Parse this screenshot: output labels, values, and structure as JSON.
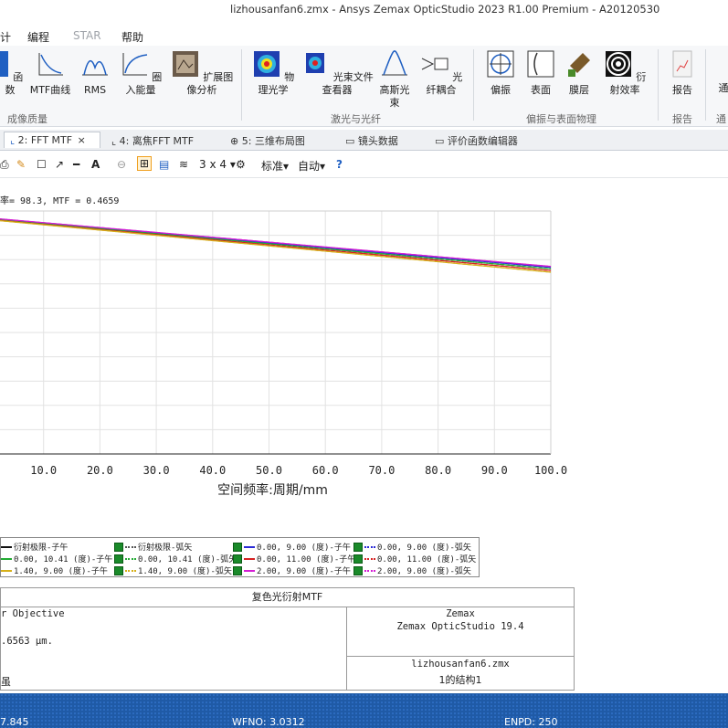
{
  "window": {
    "title": "lizhousanfan6.zmx - Ansys Zemax OpticStudio 2023 R1.00   Premium - A20120530"
  },
  "menu": {
    "items": [
      "计",
      "编程",
      "STAR",
      "帮助"
    ]
  },
  "ribbon": {
    "group1": {
      "buttons": [
        "函数",
        "MTF曲线",
        "RMS",
        "圈入能量",
        "扩展图像分析"
      ],
      "label": "成像质量"
    },
    "group2": {
      "buttons": [
        "物理光学",
        "光束文件查看器",
        "高斯光束",
        "光纤耦合"
      ],
      "label": "激光与光纤"
    },
    "group3": {
      "buttons": [
        "偏振",
        "表面",
        "膜层",
        "衍射效率"
      ],
      "label": "偏振与表面物理"
    },
    "group4": {
      "buttons": [
        "报告"
      ],
      "label": "报告"
    },
    "group5": {
      "buttons": [
        "通"
      ],
      "label": "通"
    }
  },
  "tabs": [
    {
      "label": "2: FFT MTF",
      "close": "×",
      "active": true
    },
    {
      "label": "4: 离焦FFT MTF",
      "active": false
    },
    {
      "label": "5: 三维布局图",
      "active": false
    },
    {
      "label": "镜头数据",
      "active": false
    },
    {
      "label": "评价函数编辑器",
      "active": false
    }
  ],
  "toolbar": {
    "layout": "3 x 4",
    "layout_arrow": "▾",
    "standard": "标准",
    "auto": "自动",
    "dropdown_arrow": "▾"
  },
  "plot_header": "率= 98.3, MTF = 0.4659",
  "chart_data": {
    "type": "line",
    "xlabel": "空间频率:周期/mm",
    "ylabel": "",
    "x_ticks": [
      "10.0",
      "20.0",
      "30.0",
      "40.0",
      "50.0",
      "60.0",
      "70.0",
      "80.0",
      "90.0",
      "100.0"
    ],
    "x_range_visible": [
      0,
      100
    ],
    "y_range": [
      0,
      1.0
    ],
    "grid": true,
    "series": [
      {
        "name": "衍射极限-子午",
        "color": "#111111",
        "x": [
          0,
          100
        ],
        "y": [
          0.97,
          0.77
        ]
      },
      {
        "name": "衍射极限-弧矢",
        "color": "#555555",
        "x": [
          0,
          100
        ],
        "y": [
          0.97,
          0.77
        ]
      },
      {
        "name": "0.00, 9.00 (度)-子午",
        "color": "#2b2bd6",
        "x": [
          0,
          100
        ],
        "y": [
          0.97,
          0.768
        ]
      },
      {
        "name": "0.00, 9.00 (度)-弧矢",
        "color": "#2b2bd6",
        "x": [
          0,
          100
        ],
        "y": [
          0.97,
          0.768
        ]
      },
      {
        "name": "0.00, 10.41 (度)-子午",
        "color": "#22aa33",
        "x": [
          0,
          100
        ],
        "y": [
          0.968,
          0.762
        ]
      },
      {
        "name": "0.00, 10.41 (度)-弧矢",
        "color": "#22aa33",
        "x": [
          0,
          100
        ],
        "y": [
          0.968,
          0.762
        ]
      },
      {
        "name": "0.00, 11.00 (度)-子午",
        "color": "#d62222",
        "x": [
          0,
          100
        ],
        "y": [
          0.966,
          0.755
        ]
      },
      {
        "name": "0.00, 11.00 (度)-弧矢",
        "color": "#d62222",
        "x": [
          0,
          100
        ],
        "y": [
          0.966,
          0.755
        ]
      },
      {
        "name": "1.40, 9.00 (度)-子午",
        "color": "#d6b01a",
        "x": [
          0,
          100
        ],
        "y": [
          0.965,
          0.748
        ]
      },
      {
        "name": "1.40, 9.00 (度)-弧矢",
        "color": "#d6b01a",
        "x": [
          0,
          100
        ],
        "y": [
          0.965,
          0.748
        ]
      },
      {
        "name": "2.00, 9.00 (度)-子午",
        "color": "#d41fd4",
        "x": [
          0,
          100
        ],
        "y": [
          0.972,
          0.772
        ]
      },
      {
        "name": "2.00, 9.00 (度)-弧矢",
        "color": "#d41fd4",
        "x": [
          0,
          100
        ],
        "y": [
          0.972,
          0.772
        ]
      }
    ]
  },
  "legend": [
    {
      "text": "衍射极限-子午",
      "color": "#111111",
      "dashed": false,
      "checkbox": false
    },
    {
      "text": "衍射极限-弧矢",
      "color": "#555555",
      "dashed": true,
      "checkbox": true
    },
    {
      "text": "0.00, 9.00 (度)-子午",
      "color": "#2b2bd6",
      "dashed": false,
      "checkbox": true
    },
    {
      "text": "0.00, 9.00 (度)-弧矢",
      "color": "#2b2bd6",
      "dashed": true,
      "checkbox": true
    },
    {
      "text": "0.00, 10.41 (度)-子午",
      "color": "#22aa33",
      "dashed": false,
      "checkbox": false
    },
    {
      "text": "0.00, 10.41 (度)-弧矢",
      "color": "#22aa33",
      "dashed": true,
      "checkbox": true
    },
    {
      "text": "0.00, 11.00 (度)-子午",
      "color": "#d62222",
      "dashed": false,
      "checkbox": true
    },
    {
      "text": "0.00, 11.00 (度)-弧矢",
      "color": "#d62222",
      "dashed": true,
      "checkbox": true
    },
    {
      "text": "1.40, 9.00 (度)-子午",
      "color": "#d6b01a",
      "dashed": false,
      "checkbox": false
    },
    {
      "text": "1.40, 9.00 (度)-弧矢",
      "color": "#d6b01a",
      "dashed": true,
      "checkbox": true
    },
    {
      "text": "2.00, 9.00 (度)-子午",
      "color": "#d41fd4",
      "dashed": false,
      "checkbox": true
    },
    {
      "text": "2.00, 9.00 (度)-弧矢",
      "color": "#d41fd4",
      "dashed": true,
      "checkbox": true
    }
  ],
  "infobox": {
    "title": "复色光衍射MTF",
    "left_line1": "r Objective",
    "left_line2": ".6563 µm.",
    "left_line3": "虽",
    "right_line1": "Zemax",
    "right_line2": "Zemax OpticStudio 19.4",
    "file": "lizhousanfan6.zmx",
    "config": "1的结构1"
  },
  "status": {
    "left": "7.845",
    "wfno": "WFNO: 3.0312",
    "enpd": "ENPD: 250"
  }
}
